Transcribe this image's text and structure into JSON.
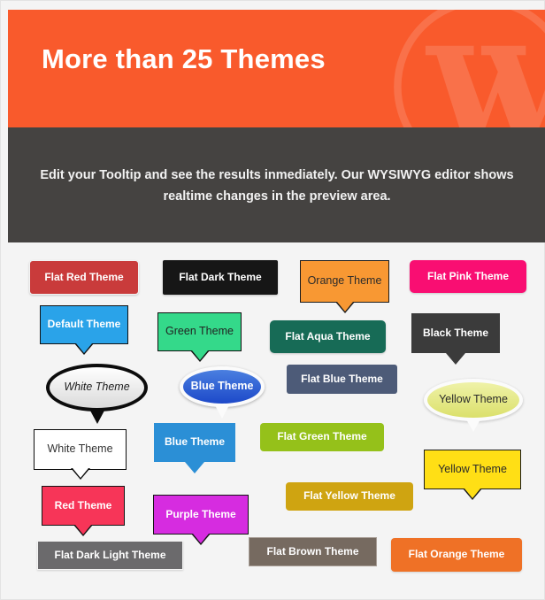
{
  "hero": {
    "title": "More than 25 Themes",
    "watermark_icon": "wordpress-logo",
    "bg_color": "#f95a2c"
  },
  "subbar": {
    "text": "Edit your Tooltip and see the results inmediately. Our WYSIWYG editor shows realtime changes in the preview area.",
    "bg_color": "#454341"
  },
  "themes": {
    "flat_red": {
      "label": "Flat Red Theme",
      "color": "#c93b3b"
    },
    "flat_dark": {
      "label": "Flat Dark Theme",
      "color": "#161616"
    },
    "orange": {
      "label": "Orange Theme",
      "color": "#f89833"
    },
    "flat_pink": {
      "label": "Flat Pink Theme",
      "color": "#f90e72"
    },
    "default": {
      "label": "Default Theme",
      "color": "#2aa3e9"
    },
    "green": {
      "label": "Green Theme",
      "color": "#34d98a"
    },
    "flat_aqua": {
      "label": "Flat Aqua Theme",
      "color": "#176b56"
    },
    "black": {
      "label": "Black Theme",
      "color": "#3b3b3b"
    },
    "white_ellipse": {
      "label": "White Theme",
      "color": "#ffffff"
    },
    "blue_ellipse": {
      "label": "Blue Theme",
      "color": "#1d49c9"
    },
    "flat_blue": {
      "label": "Flat Blue Theme",
      "color": "#4d5b78"
    },
    "yellow_ellipse": {
      "label": "Yellow Theme",
      "color": "#dbe06b"
    },
    "white_box": {
      "label": "White Theme",
      "color": "#ffffff"
    },
    "blue_box": {
      "label": "Blue Theme",
      "color": "#2b8fd6"
    },
    "flat_green": {
      "label": "Flat Green Theme",
      "color": "#95c11a"
    },
    "yellow_box": {
      "label": "Yellow Theme",
      "color": "#ffdf15"
    },
    "flat_yellow": {
      "label": "Flat Yellow Theme",
      "color": "#cfa411"
    },
    "red": {
      "label": "Red Theme",
      "color": "#f73558"
    },
    "purple": {
      "label": "Purple Theme",
      "color": "#d62ce0"
    },
    "flat_dark_light": {
      "label": "Flat Dark Light Theme",
      "color": "#6b6a6c"
    },
    "flat_brown": {
      "label": "Flat Brown Theme",
      "color": "#766a60"
    },
    "flat_orange": {
      "label": "Flat Orange Theme",
      "color": "#ef7126"
    }
  }
}
